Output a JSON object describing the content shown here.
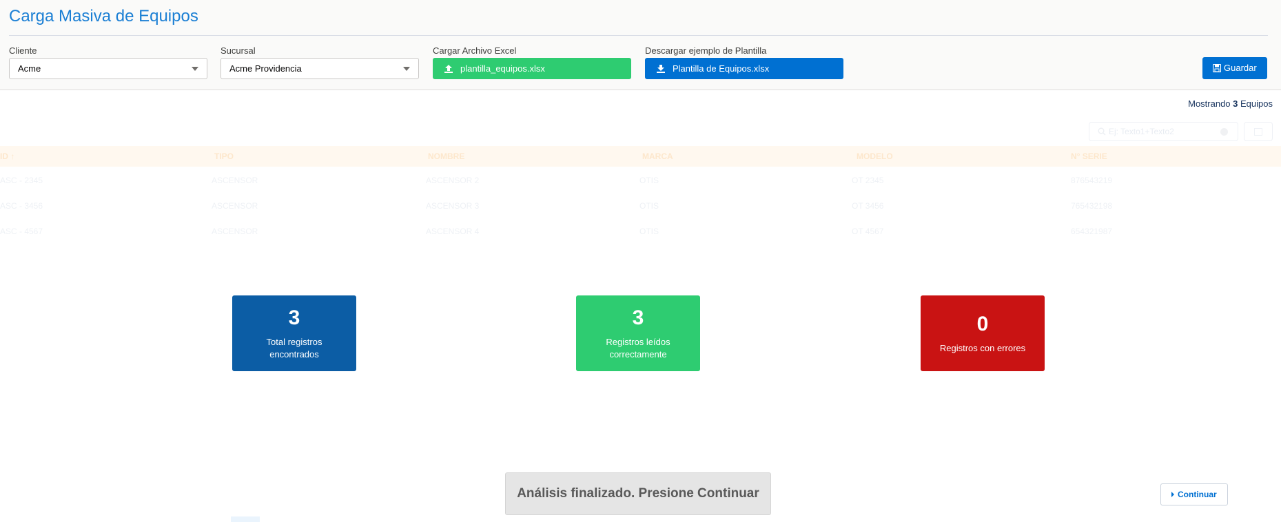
{
  "page": {
    "title": "Carga Masiva de Equipos"
  },
  "form": {
    "cliente_label": "Cliente",
    "cliente_value": "Acme",
    "sucursal_label": "Sucursal",
    "sucursal_value": "Acme Providencia",
    "upload_label": "Cargar Archivo Excel",
    "upload_file": "plantilla_equipos.xlsx",
    "download_label": "Descargar ejemplo de Plantilla",
    "download_file": "Plantilla de Equipos.xlsx",
    "save_label": "Guardar"
  },
  "table": {
    "showing_prefix": "Mostrando",
    "showing_count": "3",
    "showing_suffix": "Equipos",
    "search_placeholder": "Ej: Texto1+Texto2",
    "columns": [
      "ID",
      "TIPO",
      "NOMBRE",
      "MARCA",
      "MODELO",
      "N° SERIE"
    ],
    "rows": [
      [
        "ASC - 2345",
        "ASCENSOR",
        "ASCENSOR 2",
        "OTIS",
        "OT 2345",
        "876543219"
      ],
      [
        "ASC - 3456",
        "ASCENSOR",
        "ASCENSOR 3",
        "OTIS",
        "OT 3456",
        "765432198"
      ],
      [
        "ASC - 4567",
        "ASCENSOR",
        "ASCENSOR 4",
        "OTIS",
        "OT 4567",
        "654321987"
      ]
    ]
  },
  "stats": [
    {
      "value": "3",
      "label_line1": "Total registros",
      "label_line2": "encontrados",
      "color": "#0c5da5"
    },
    {
      "value": "3",
      "label_line1": "Registros leídos",
      "label_line2": "correctamente",
      "color": "#2ecc71"
    },
    {
      "value": "0",
      "label_line1": "Registros con errores",
      "label_line2": "",
      "color": "#c91313"
    }
  ],
  "status": {
    "message": "Análisis finalizado. Presione Continuar"
  },
  "actions": {
    "continue_label": "Continuar"
  },
  "colors": {
    "brand_blue": "#0070d2",
    "title_blue": "#1b7fd4",
    "success_green": "#2ecc71",
    "error_red": "#c91313"
  }
}
